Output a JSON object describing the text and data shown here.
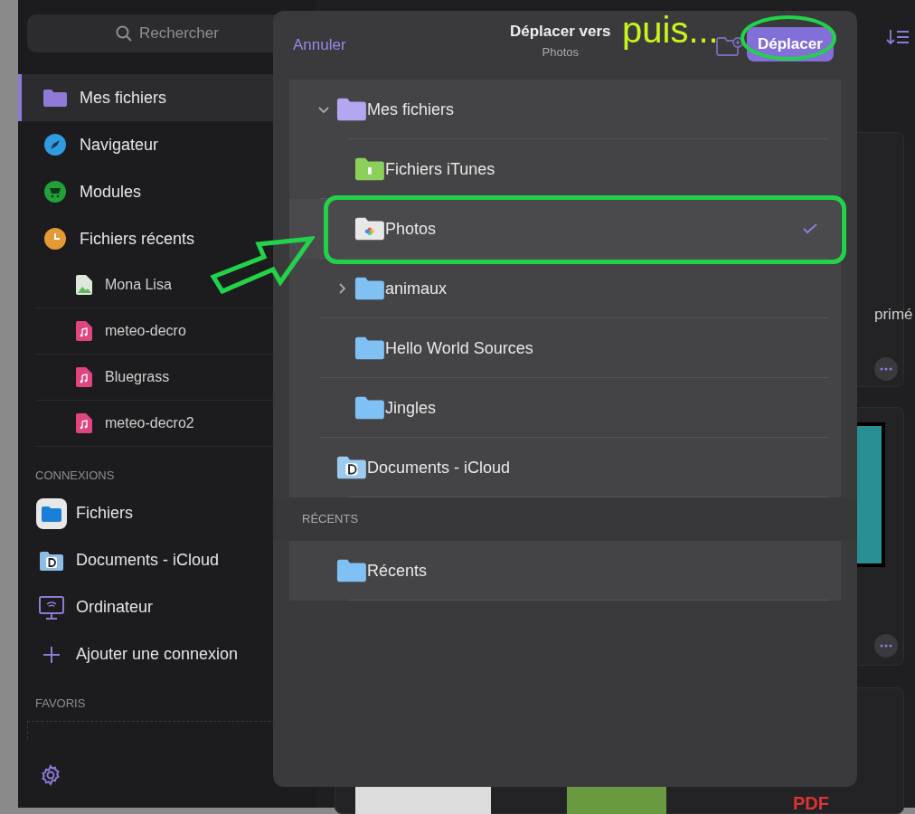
{
  "sidebar": {
    "search": {
      "placeholder": "Rechercher"
    },
    "items": [
      {
        "label": "Mes fichiers",
        "kind": "folder",
        "selected": true
      },
      {
        "label": "Navigateur",
        "kind": "compass",
        "selected": false
      },
      {
        "label": "Modules",
        "kind": "cart",
        "selected": false
      },
      {
        "label": "Fichiers récents",
        "kind": "clock",
        "selected": false
      }
    ],
    "recent_files": [
      {
        "label": "Mona Lisa",
        "kind": "image"
      },
      {
        "label": "meteo-decro",
        "kind": "audio"
      },
      {
        "label": "Bluegrass",
        "kind": "audio"
      },
      {
        "label": "meteo-decro2",
        "kind": "audio"
      }
    ],
    "connections": {
      "heading": "CONNEXIONS",
      "items": [
        {
          "label": "Fichiers",
          "kind": "files"
        },
        {
          "label": "Documents - iCloud",
          "kind": "docs"
        },
        {
          "label": "Ordinateur",
          "kind": "computer"
        },
        {
          "label": "Ajouter une connexion",
          "kind": "add"
        }
      ]
    },
    "favorites": {
      "heading": "FAVORIS"
    }
  },
  "background": {
    "card_caption": "primé",
    "badge": "PDF"
  },
  "dialog": {
    "cancel": "Annuler",
    "title": "Déplacer vers",
    "subtitle": "Photos",
    "confirm": "Déplacer",
    "tree": [
      {
        "label": "Mes fichiers",
        "kind": "purple",
        "expanded": true,
        "selected": false,
        "children": [
          {
            "label": "Fichiers iTunes",
            "kind": "itunes",
            "selected": false
          },
          {
            "label": "Photos",
            "kind": "photos",
            "selected": true
          },
          {
            "label": "animaux",
            "kind": "blue",
            "expanded": false,
            "selected": false
          },
          {
            "label": "Hello World Sources",
            "kind": "blue",
            "selected": false
          },
          {
            "label": "Jingles",
            "kind": "blue",
            "selected": false
          }
        ]
      },
      {
        "label": "Documents - iCloud",
        "kind": "docs",
        "selected": false
      }
    ],
    "recents": {
      "heading": "RÉCENTS",
      "items": [
        {
          "label": "Récents",
          "kind": "blue",
          "selected": false
        }
      ]
    }
  },
  "annotation": {
    "text": "puis..."
  }
}
